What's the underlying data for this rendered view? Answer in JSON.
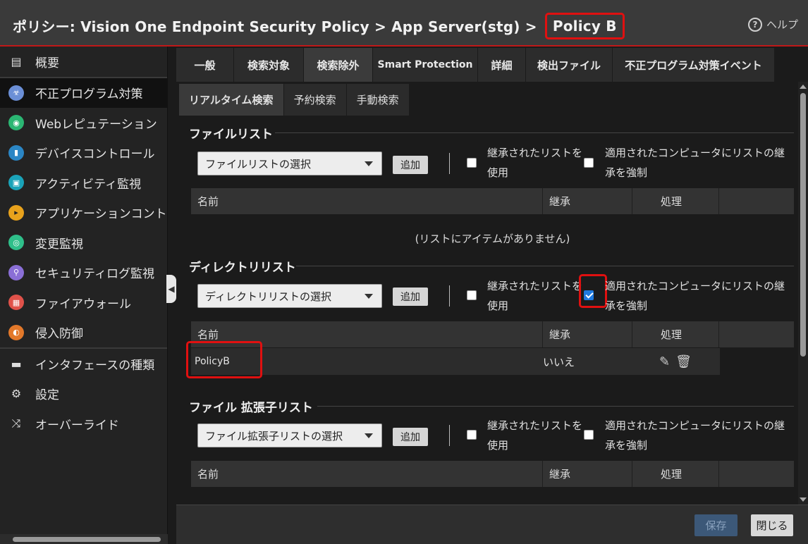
{
  "header": {
    "title_prefix": "ポリシー: Vision One Endpoint Security Policy > App Server(stg) >",
    "title_highlight": "Policy B",
    "help_label": "ヘルプ"
  },
  "sidebar": {
    "items": [
      {
        "label": "概要",
        "icon": "overview-icon"
      },
      {
        "label": "不正プログラム対策",
        "icon": "biohazard-icon"
      },
      {
        "label": "Webレピュテーション",
        "icon": "web-reputation-icon"
      },
      {
        "label": "デバイスコントロール",
        "icon": "device-control-icon"
      },
      {
        "label": "アクティビティ監視",
        "icon": "activity-monitor-icon"
      },
      {
        "label": "アプリケーションコントロール",
        "icon": "app-control-icon"
      },
      {
        "label": "変更監視",
        "icon": "integrity-monitor-icon"
      },
      {
        "label": "セキュリティログ監視",
        "icon": "log-inspection-icon"
      },
      {
        "label": "ファイアウォール",
        "icon": "firewall-icon"
      },
      {
        "label": "侵入防御",
        "icon": "intrusion-prevention-icon"
      },
      {
        "label": "インタフェースの種類",
        "icon": "interface-icon"
      },
      {
        "label": "設定",
        "icon": "gear-icon"
      },
      {
        "label": "オーバーライド",
        "icon": "shuffle-icon"
      }
    ]
  },
  "tabs": [
    "一般",
    "検索対象",
    "検索除外",
    "Smart Protection",
    "詳細",
    "検出ファイル",
    "不正プログラム対策イベント"
  ],
  "subtabs": [
    "リアルタイム検索",
    "予約検索",
    "手動検索"
  ],
  "sections": {
    "file_list": {
      "title": "ファイルリスト",
      "dropdown": "ファイルリストの選択",
      "empty": "(リストにアイテムがありません)"
    },
    "dir_list": {
      "title": "ディレクトリリスト",
      "dropdown": "ディレクトリリストの選択",
      "rows": [
        {
          "name": "PolicyB",
          "inherited": "いいえ"
        }
      ]
    },
    "ext_list": {
      "title": "ファイル 拡張子リスト",
      "dropdown": "ファイル拡張子リストの選択"
    }
  },
  "common": {
    "add": "追加",
    "use_inherited_1": "継承されたリストを",
    "use_inherited_2": "使用",
    "force_1": "適用されたコンピュータにリストの継",
    "force_2": "承を強制",
    "col_name": "名前",
    "col_inherit": "継承",
    "col_action": "処理"
  },
  "footer": {
    "save": "保存",
    "close": "閉じる"
  },
  "colors": {
    "highlight": "#e01010",
    "checkbox": "#1f7ae0"
  }
}
